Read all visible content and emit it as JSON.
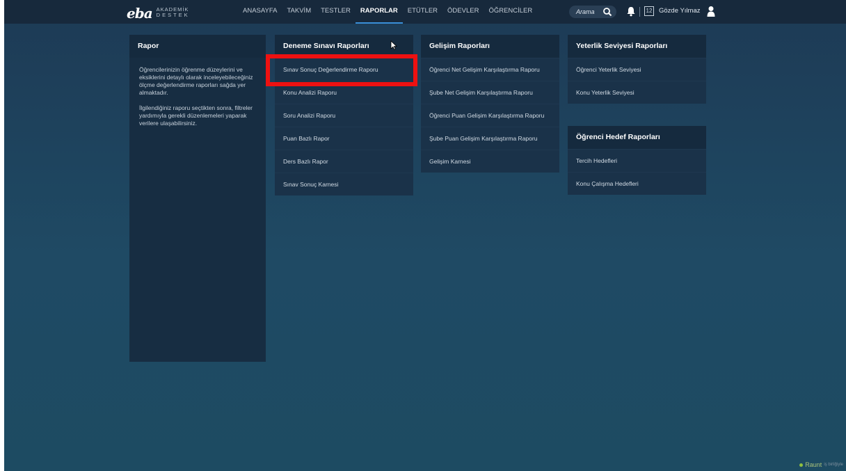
{
  "logo": {
    "brand": "eba",
    "line1": "AKADEMİK",
    "line2": "DESTEK"
  },
  "nav": [
    "ANASAYFA",
    "TAKVİM",
    "TESTLER",
    "RAPORLAR",
    "ETÜTLER",
    "ÖDEVLER",
    "ÖĞRENCİLER"
  ],
  "nav_active": "RAPORLAR",
  "search": {
    "label": "Arama"
  },
  "calendar_day": "12",
  "user": {
    "name": "Gözde Yılmaz"
  },
  "intro": {
    "title": "Rapor",
    "paragraph1": "Öğrencilerinizin öğrenme düzeylerini ve eksiklerini detaylı olarak inceleyebileceğiniz ölçme değerlendirme raporları sağda yer almaktadır.",
    "paragraph2": "İlgilendiğiniz raporu seçtikten sonra, filtreler yardımıyla gerekli düzenlemeleri yaparak verilere ulaşabilirsiniz."
  },
  "deneme": {
    "title": "Deneme Sınavı Raporları",
    "items": [
      "Sınav Sonuç Değerlendirme Raporu",
      "Konu Analizi Raporu",
      "Soru Analizi Raporu",
      "Puan Bazlı Rapor",
      "Ders Bazlı Rapor",
      "Sınav Sonuç Karnesi"
    ]
  },
  "gelisim": {
    "title": "Gelişim Raporları",
    "items": [
      "Öğrenci Net Gelişim Karşılaştırma Raporu",
      "Şube Net Gelişim Karşılaştırma Raporu",
      "Öğrenci Puan Gelişim Karşılaştırma Raporu",
      "Şube Puan Gelişim Karşılaştırma Raporu",
      "Gelişim Karnesi"
    ]
  },
  "yeterlik": {
    "title": "Yeterlik Seviyesi Raporları",
    "items": [
      "Öğrenci Yeterlik Seviyesi",
      "Konu Yeterlik Seviyesi"
    ]
  },
  "hedef": {
    "title": "Öğrenci Hedef Raporları",
    "items": [
      "Tercih Hedefleri",
      "Konu Çalışma Hedefleri"
    ]
  },
  "watermark": {
    "brand": "Raunt",
    "suffix": "iş birliğiyle"
  },
  "colors": {
    "highlight": "#ee1111",
    "active_underline": "#3a8fd8",
    "background": "#1e4560"
  }
}
